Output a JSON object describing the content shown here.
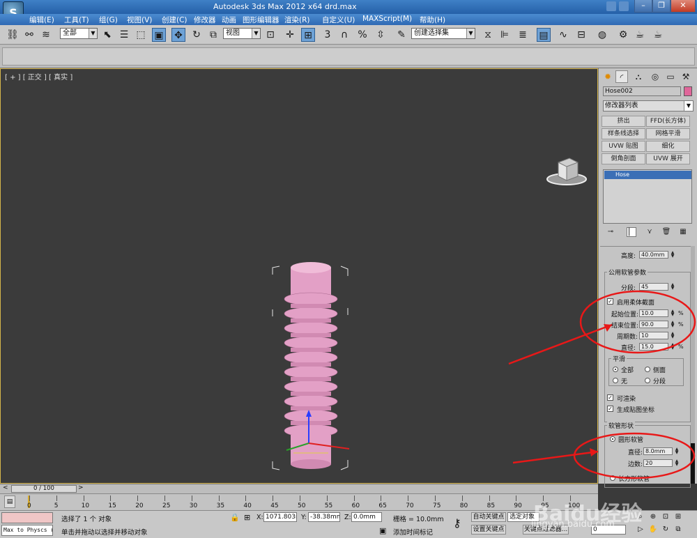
{
  "titlebar": {
    "title": "Autodesk 3ds Max  2012 x64      drd.max"
  },
  "menu": [
    "编辑(E)",
    "工具(T)",
    "组(G)",
    "视图(V)",
    "创建(C)",
    "修改器",
    "动画",
    "图形编辑器",
    "渲染(R)",
    "自定义(U)",
    "MAXScript(M)",
    "帮助(H)"
  ],
  "toolbar": {
    "selection_filter": "全部",
    "ref_coord": "视图",
    "named_selection": "创建选择集",
    "snap_angle_label": "3",
    "percent_label": "%"
  },
  "viewport": {
    "label": "[ + ] [ 正交 ] [ 真实 ]",
    "object_color": "#e8a2c8"
  },
  "command_panel": {
    "object_name": "Hose002",
    "object_color": "#e0669a",
    "modifier_list": "修改器列表",
    "modifier_buttons": [
      "挤出",
      "FFD(长方体)",
      "样条线选择",
      "网格平滑",
      "UVW 贴图",
      "细化",
      "倒角剖面",
      "UVW 展开"
    ],
    "stack_item": "Hose",
    "params": {
      "height_label": "高度:",
      "height_value": "40.0mm",
      "common_group": "公用软管参数",
      "segments_label": "分段:",
      "segments_value": "45",
      "flex_label": "启用柔体截面",
      "start_label": "起始位置:",
      "start_value": "10.0",
      "end_label": "结束位置:",
      "end_value": "90.0",
      "cycles_label": "周期数:",
      "cycles_value": "10",
      "diameter_label": "直径:",
      "diameter_value": "15.0",
      "unit_pct": "%",
      "smooth_group": "平滑",
      "smooth_all": "全部",
      "smooth_sides": "侧面",
      "smooth_none": "无",
      "smooth_segments": "分段",
      "renderable": "可渲染",
      "gen_mapping": "生成贴图坐标",
      "shape_group": "软管形状",
      "round_hose": "圆形软管",
      "round_diameter_label": "直径:",
      "round_diameter_value": "8.0mm",
      "sides_label": "边数:",
      "sides_value": "20",
      "rect_hose": "长方形软管"
    }
  },
  "timeline": {
    "frame": "0 / 100",
    "ticks": [
      "0",
      "5",
      "10",
      "15",
      "20",
      "25",
      "30",
      "35",
      "40",
      "45",
      "50",
      "55",
      "60",
      "65",
      "70",
      "75",
      "80",
      "85",
      "90",
      "95",
      "100"
    ]
  },
  "status": {
    "maxscript": "Max to Physcs (",
    "selected": "选择了 1 个 对象",
    "prompt": "单击并拖动以选择并移动对象",
    "x_label": "X:",
    "x_value": "1071.803m",
    "y_label": "Y:",
    "y_value": "-38.38mm",
    "z_label": "Z:",
    "z_value": "0.0mm",
    "grid": "栅格 = 10.0mm",
    "add_time_tag": "添加时间标记",
    "auto_key": "自动关键点",
    "set_key": "设置关键点",
    "selected_obj": "选定对象",
    "key_filter": "关键点过滤器...",
    "frame_field": "0"
  },
  "watermark": {
    "brand": "Baidu经验",
    "url": "jingyan.baidu.com"
  }
}
